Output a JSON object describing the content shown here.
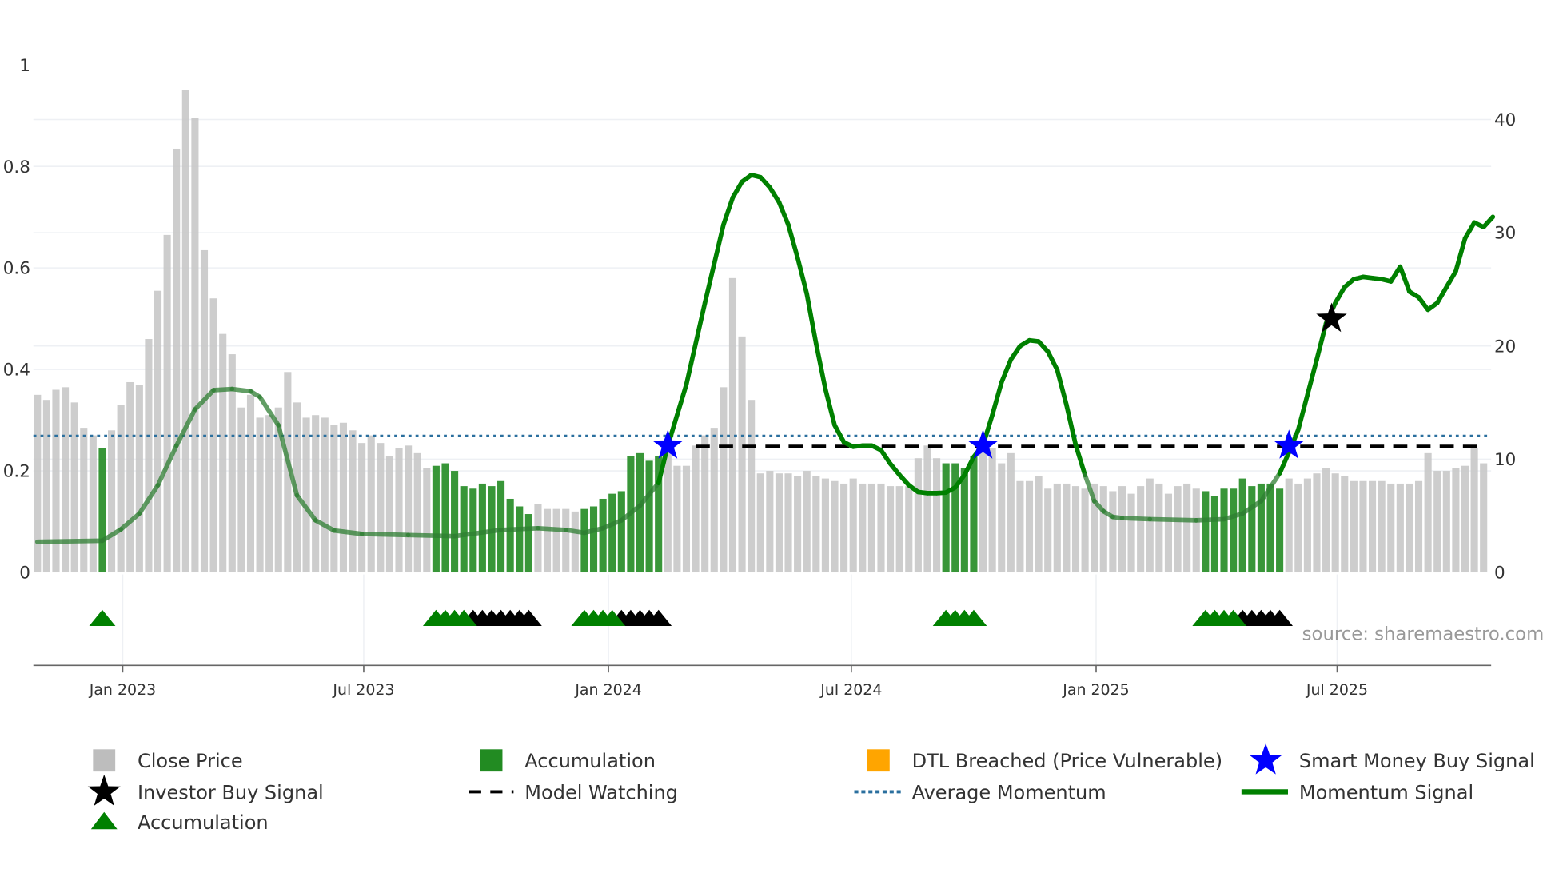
{
  "chart_data": {
    "type": "bar+line",
    "x_unit": "week index",
    "x_ticks": [
      {
        "label": "Jan 2023",
        "index": 9.2
      },
      {
        "label": "Jul 2023",
        "index": 35.2
      },
      {
        "label": "Jan 2024",
        "index": 61.6
      },
      {
        "label": "Jul 2024",
        "index": 87.8
      },
      {
        "label": "Jan 2025",
        "index": 114.2
      },
      {
        "label": "Jul 2025",
        "index": 140.2
      }
    ],
    "left_axis": {
      "ylim": [
        0,
        1
      ],
      "ticks": [
        "0",
        "0.2",
        "0.4",
        "0.6",
        "0.8",
        "1"
      ],
      "tick_values": [
        0,
        0.2,
        0.4,
        0.6,
        0.8,
        1
      ]
    },
    "right_axis": {
      "ylim": [
        0,
        44.8
      ],
      "ticks": [
        "0",
        "10",
        "20",
        "30",
        "40"
      ],
      "tick_values": [
        0,
        10,
        20,
        30,
        40
      ]
    },
    "close_price": [
      0.35,
      0.34,
      0.36,
      0.365,
      0.335,
      0.285,
      0.27,
      0.245,
      0.28,
      0.33,
      0.375,
      0.37,
      0.46,
      0.555,
      0.665,
      0.835,
      0.95,
      0.895,
      0.635,
      0.54,
      0.47,
      0.43,
      0.325,
      0.35,
      0.305,
      0.31,
      0.325,
      0.395,
      0.335,
      0.305,
      0.31,
      0.305,
      0.29,
      0.295,
      0.28,
      0.255,
      0.27,
      0.255,
      0.23,
      0.245,
      0.25,
      0.235,
      0.205,
      0.21,
      0.215,
      0.2,
      0.17,
      0.165,
      0.175,
      0.17,
      0.18,
      0.145,
      0.13,
      0.115,
      0.135,
      0.125,
      0.125,
      0.125,
      0.12,
      0.125,
      0.13,
      0.145,
      0.155,
      0.16,
      0.23,
      0.235,
      0.22,
      0.23,
      0.255,
      0.21,
      0.21,
      0.25,
      0.27,
      0.285,
      0.365,
      0.58,
      0.465,
      0.34,
      0.195,
      0.2,
      0.195,
      0.195,
      0.19,
      0.2,
      0.19,
      0.185,
      0.18,
      0.175,
      0.185,
      0.175,
      0.175,
      0.175,
      0.17,
      0.17,
      0.17,
      0.225,
      0.25,
      0.225,
      0.215,
      0.215,
      0.205,
      0.23,
      0.255,
      0.245,
      0.215,
      0.235,
      0.18,
      0.18,
      0.19,
      0.165,
      0.175,
      0.175,
      0.17,
      0.165,
      0.175,
      0.17,
      0.16,
      0.17,
      0.155,
      0.17,
      0.185,
      0.175,
      0.155,
      0.17,
      0.175,
      0.165,
      0.16,
      0.15,
      0.165,
      0.165,
      0.185,
      0.17,
      0.175,
      0.175,
      0.165,
      0.185,
      0.175,
      0.185,
      0.195,
      0.205,
      0.195,
      0.19,
      0.18,
      0.18,
      0.18,
      0.18,
      0.175,
      0.175,
      0.175,
      0.18,
      0.235,
      0.2,
      0.2,
      0.205,
      0.21,
      0.245,
      0.215
    ],
    "accumulation_bar_ranges": [
      [
        7,
        7
      ],
      [
        43,
        53
      ],
      [
        59,
        67
      ],
      [
        98,
        101
      ],
      [
        126,
        134
      ]
    ],
    "momentum_signal": [
      [
        0,
        2.7
      ],
      [
        7,
        2.8
      ],
      [
        9,
        3.8
      ],
      [
        11,
        5.2
      ],
      [
        13,
        7.7
      ],
      [
        15,
        11.2
      ],
      [
        17,
        14.4
      ],
      [
        19,
        16.1
      ],
      [
        21,
        16.2
      ],
      [
        23,
        16
      ],
      [
        24,
        15.5
      ],
      [
        26,
        13
      ],
      [
        28,
        6.8
      ],
      [
        30,
        4.6
      ],
      [
        32,
        3.7
      ],
      [
        35,
        3.4
      ],
      [
        40,
        3.3
      ],
      [
        45,
        3.2
      ],
      [
        50,
        3.75
      ],
      [
        54,
        3.9
      ],
      [
        57,
        3.75
      ],
      [
        59,
        3.5
      ],
      [
        61,
        3.9
      ],
      [
        63,
        4.6
      ],
      [
        65,
        5.9
      ],
      [
        67,
        7.9
      ],
      [
        68,
        11.2
      ],
      [
        70,
        16.6
      ],
      [
        72,
        23.8
      ],
      [
        74,
        30.7
      ],
      [
        75,
        33.1
      ],
      [
        76,
        34.5
      ],
      [
        77,
        35.1
      ],
      [
        78,
        34.9
      ],
      [
        79,
        34
      ],
      [
        80,
        32.7
      ],
      [
        81,
        30.7
      ],
      [
        82,
        27.8
      ],
      [
        83,
        24.6
      ],
      [
        84,
        20.2
      ],
      [
        85,
        16.2
      ],
      [
        86,
        13
      ],
      [
        87,
        11.5
      ],
      [
        88,
        11.1
      ],
      [
        89,
        11.2
      ],
      [
        90,
        11.2
      ],
      [
        91,
        10.8
      ],
      [
        92,
        9.6
      ],
      [
        93,
        8.6
      ],
      [
        94,
        7.7
      ],
      [
        95,
        7.1
      ],
      [
        96,
        7.0
      ],
      [
        97,
        7.0
      ],
      [
        98,
        7.05
      ],
      [
        99,
        7.5
      ],
      [
        100,
        8.6
      ],
      [
        101,
        10.2
      ],
      [
        102,
        11.25
      ],
      [
        103,
        13.9
      ],
      [
        104,
        16.8
      ],
      [
        105,
        18.8
      ],
      [
        106,
        20
      ],
      [
        107,
        20.5
      ],
      [
        108,
        20.4
      ],
      [
        109,
        19.5
      ],
      [
        110,
        17.9
      ],
      [
        111,
        14.8
      ],
      [
        112,
        11.25
      ],
      [
        113,
        8.6
      ],
      [
        114,
        6.3
      ],
      [
        115,
        5.4
      ],
      [
        116,
        4.9
      ],
      [
        117,
        4.8
      ],
      [
        120,
        4.7
      ],
      [
        125,
        4.6
      ],
      [
        128,
        4.7
      ],
      [
        130,
        5.2
      ],
      [
        132,
        6.3
      ],
      [
        134,
        8.75
      ],
      [
        135,
        10.6
      ],
      [
        136,
        12.6
      ],
      [
        137,
        15.7
      ],
      [
        138,
        18.8
      ],
      [
        139,
        22
      ],
      [
        140,
        23.8
      ],
      [
        141,
        25.2
      ],
      [
        142,
        25.9
      ],
      [
        143,
        26.1
      ],
      [
        144,
        26
      ],
      [
        145,
        25.9
      ],
      [
        146,
        25.7
      ],
      [
        147,
        27
      ],
      [
        148,
        24.8
      ],
      [
        149,
        24.3
      ],
      [
        150,
        23.2
      ],
      [
        151,
        23.8
      ],
      [
        152,
        25.2
      ],
      [
        153,
        26.6
      ],
      [
        154,
        29.5
      ],
      [
        155,
        30.9
      ],
      [
        156,
        30.5
      ],
      [
        157,
        31.4
      ]
    ],
    "momentum_weak_ranges": [
      [
        0,
        67
      ],
      [
        113,
        134
      ]
    ],
    "average_momentum": 12.05,
    "model_watching": {
      "level": 11.15,
      "from_index": 71
    },
    "smart_money_buy_signals": [
      [
        68,
        11.2
      ],
      [
        102,
        11.2
      ],
      [
        135,
        11.2
      ]
    ],
    "investor_buy_signals": [
      [
        139.6,
        22.4
      ]
    ],
    "accumulation_markers": {
      "green": [
        7,
        43,
        44,
        45,
        46,
        59,
        60,
        61,
        62,
        98,
        99,
        100,
        101,
        126,
        127,
        128,
        129
      ],
      "black": [
        47,
        48,
        49,
        50,
        51,
        52,
        53,
        63,
        64,
        65,
        66,
        67,
        130,
        131,
        132,
        133,
        134
      ]
    },
    "source": "source: sharemaestro.com",
    "legend": [
      {
        "label": "Close Price",
        "color": "#bdbdbd",
        "kind": "square"
      },
      {
        "label": "Accumulation",
        "color": "#228b22",
        "kind": "square"
      },
      {
        "label": "DTL Breached (Price Vulnerable)",
        "color": "#ffa500",
        "kind": "square"
      },
      {
        "label": "Smart Money Buy Signal",
        "color": "#0000ff",
        "kind": "star"
      },
      {
        "label": "Investor Buy Signal",
        "color": "#000000",
        "kind": "star"
      },
      {
        "label": "Model Watching",
        "color": "#000000",
        "kind": "dash"
      },
      {
        "label": "Average Momentum",
        "color": "#2a6f9e",
        "kind": "dot"
      },
      {
        "label": "Momentum Signal",
        "color": "#008000",
        "kind": "line"
      },
      {
        "label": "Accumulation",
        "color": "#008000",
        "kind": "triangle"
      }
    ]
  }
}
